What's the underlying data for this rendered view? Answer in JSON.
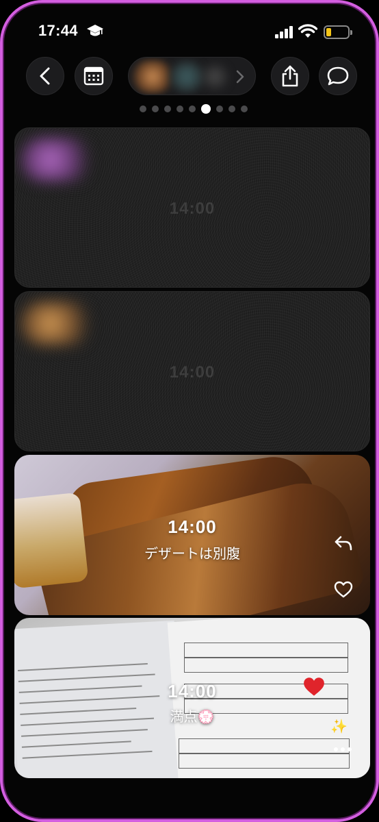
{
  "status_bar": {
    "time": "17:44",
    "focus_icon": "graduation-cap-icon",
    "battery_color": "#f5c518"
  },
  "toolbar": {
    "back_icon": "chevron-left-icon",
    "calendar_icon": "calendar-icon",
    "share_icon": "share-icon",
    "comment_icon": "speech-bubble-icon"
  },
  "pager": {
    "total": 9,
    "active_index": 5
  },
  "posts": [
    {
      "state": "locked",
      "time": "14:00"
    },
    {
      "state": "locked",
      "time": "14:00"
    },
    {
      "state": "visible",
      "time": "14:00",
      "caption": "デザートは別腹",
      "reaction_icons": [
        "reply-icon",
        "heart-outline-icon"
      ]
    },
    {
      "state": "visible",
      "time": "14:00",
      "caption": "満点💮",
      "reaction_icons": [
        "heart-red-icon",
        "sparkle-icon",
        "more-icon"
      ]
    }
  ],
  "colors": {
    "frame_border": "#d35ee0",
    "button_bg": "#1c1c1e",
    "heart_red": "#e0242b"
  }
}
